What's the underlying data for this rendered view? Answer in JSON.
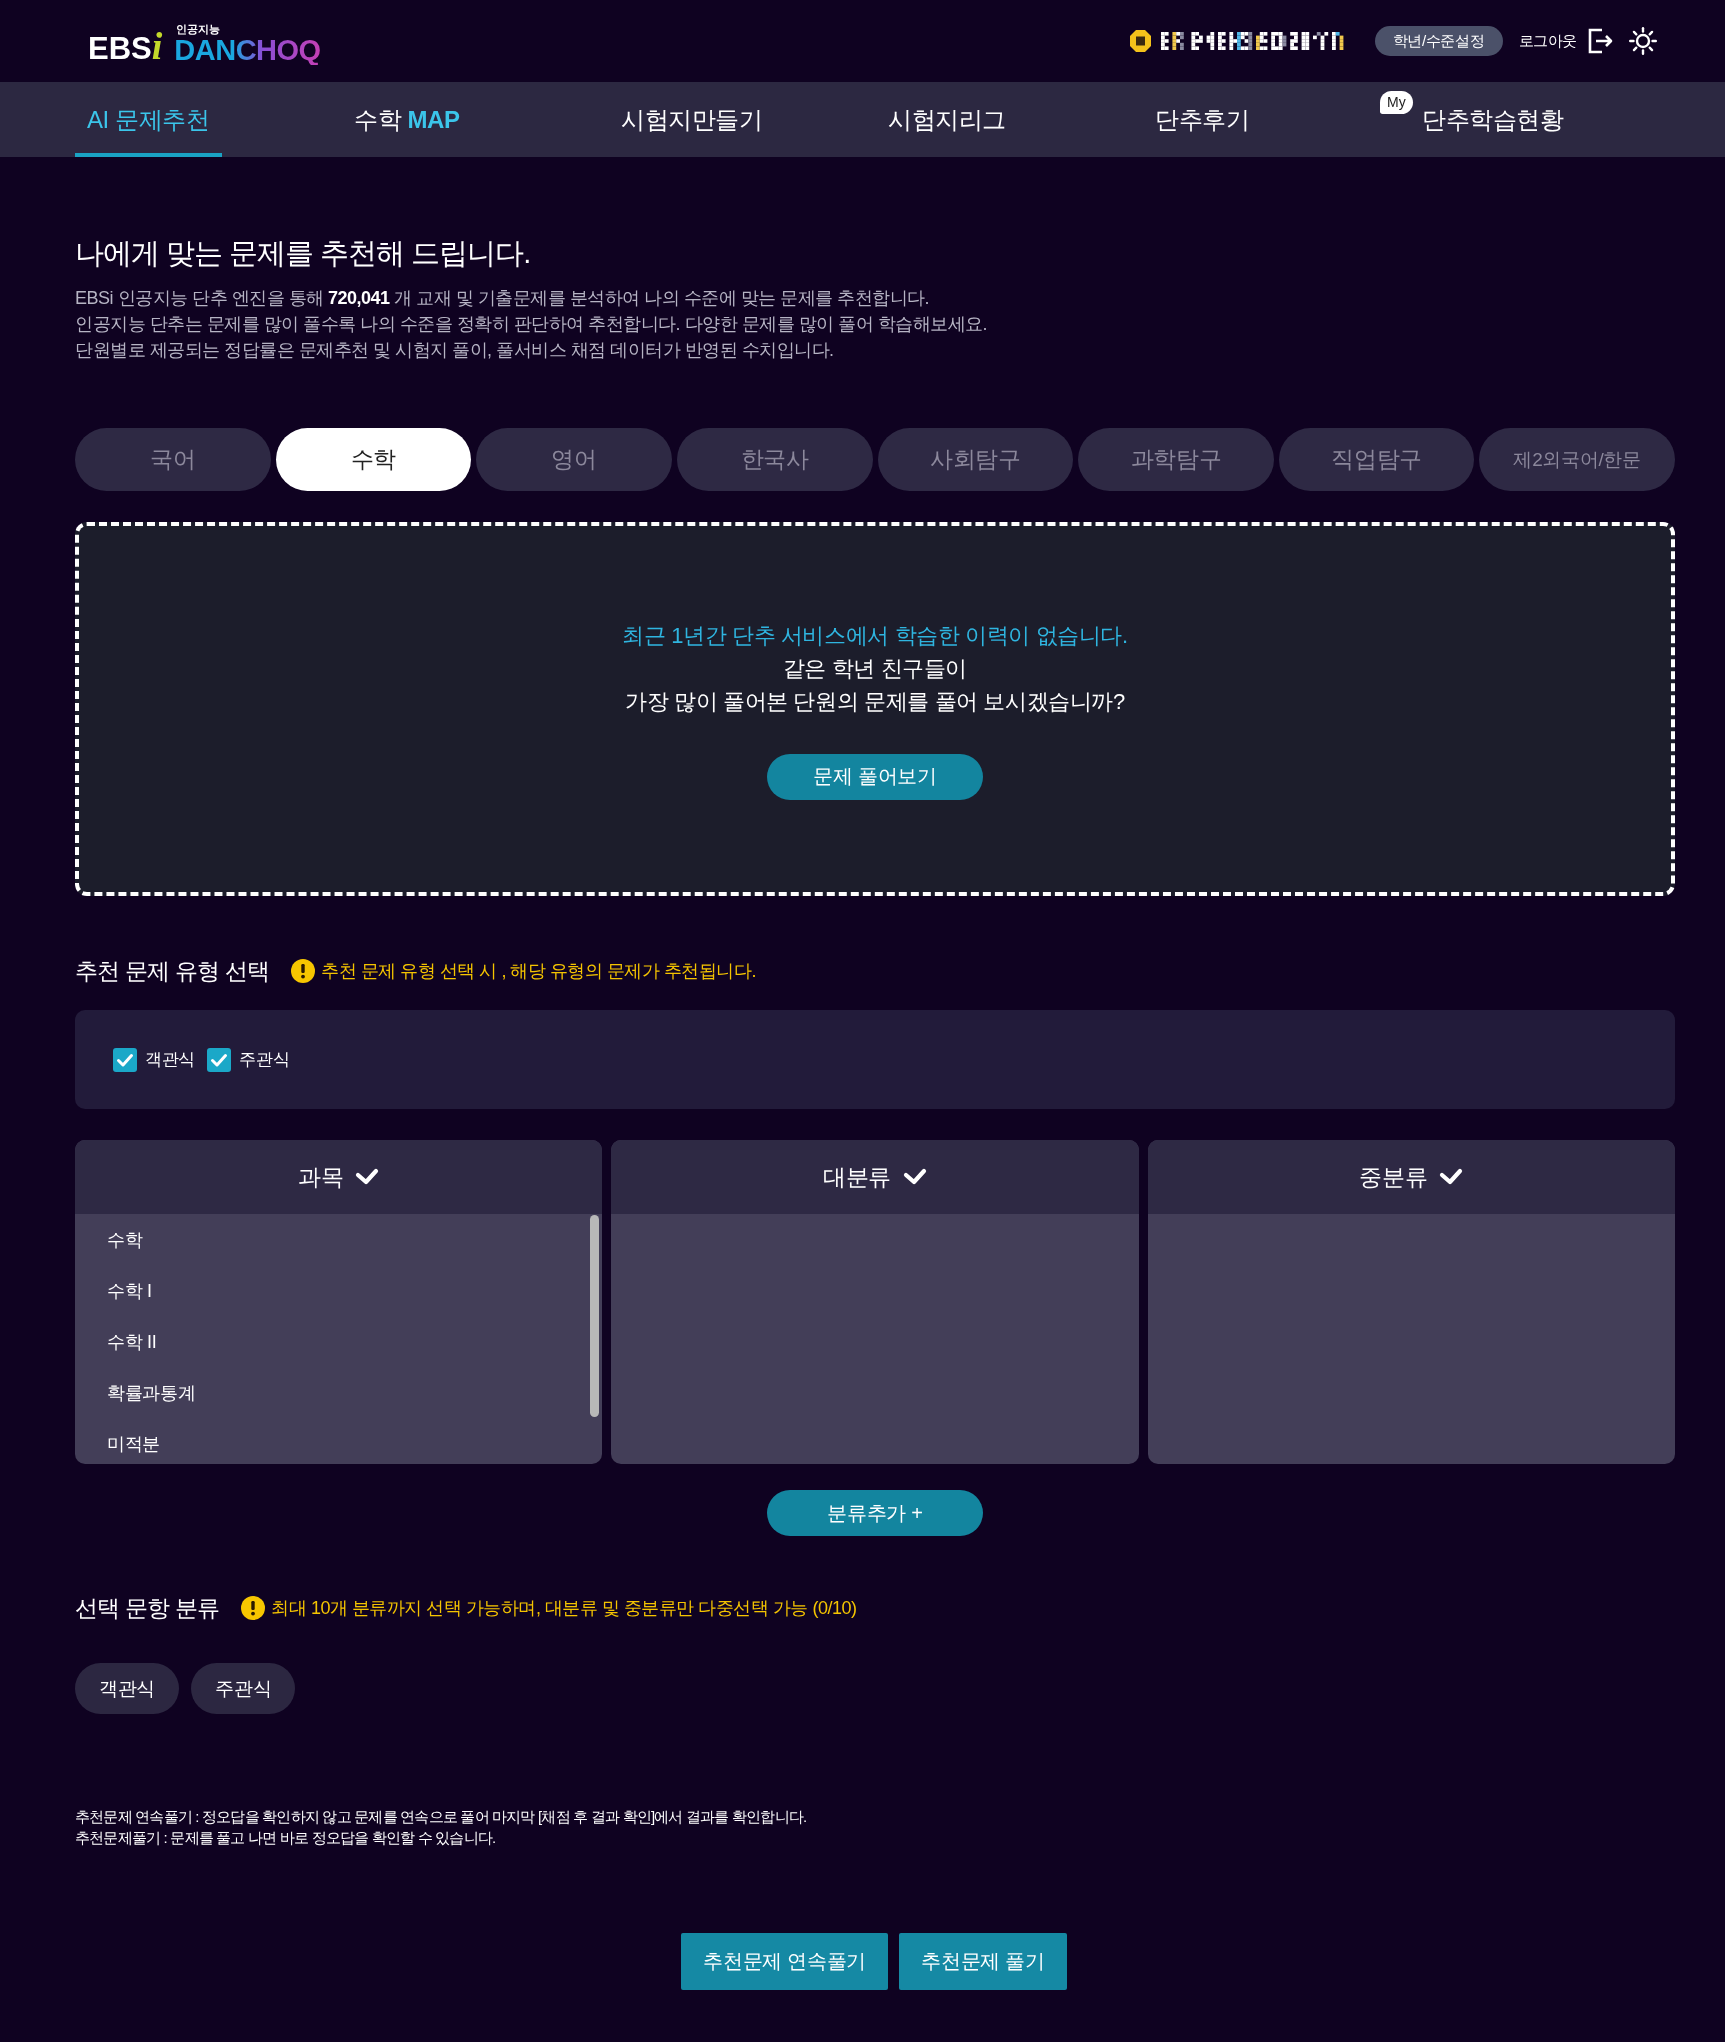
{
  "header": {
    "logo": {
      "brand": "EBS",
      "brand_accent": "i",
      "tagline": "인공지능",
      "name": "DANCHOQ"
    },
    "grade_button": "학년/수준설정",
    "logout": "로그아웃"
  },
  "nav": [
    {
      "label": "AI 문제추천",
      "selected": true
    },
    {
      "label": "수학",
      "accent": "MAP",
      "selected": false
    },
    {
      "label": "시험지만들기",
      "selected": false
    },
    {
      "label": "시험지리그",
      "selected": false
    },
    {
      "label": "단추후기",
      "selected": false
    },
    {
      "label": "단추학습현황",
      "badge": "My",
      "selected": false
    }
  ],
  "intro": {
    "title": "나에게 맞는 문제를 추천해 드립니다.",
    "body": "EBSi 인공지능 단추 엔진을 통해 **720,041** 개 교재 및 기출문제를 분석하여 나의 수준에 맞는 문제를 추천합니다.\n인공지능 단추는 문제를 많이 풀수록 나의 수준을 정확히 판단하여 추천합니다. 다양한 문제를 많이 풀어 학습해보세요.\n단원별로 제공되는 정답률은 문제추천 및 시험지 풀이, 풀서비스 채점 데이터가 반영된 수치입니다."
  },
  "subjects": [
    {
      "label": "국어",
      "selected": false
    },
    {
      "label": "수학",
      "selected": true
    },
    {
      "label": "영어",
      "selected": false
    },
    {
      "label": "한국사",
      "selected": false
    },
    {
      "label": "사회탐구",
      "selected": false
    },
    {
      "label": "과학탐구",
      "selected": false
    },
    {
      "label": "직업탐구",
      "selected": false
    },
    {
      "label": "제2외국어/한문",
      "selected": false
    }
  ],
  "empty_notice": {
    "message": "최근 1년간 단추 서비스에서 학습한 이력이 없습니다.",
    "prompt": "같은 학년 친구들이\n가장 많이 풀어본 단원의 문제를 풀어 보시겠습니까?",
    "button": "문제 풀어보기"
  },
  "type_section": {
    "title": "추천 문제 유형 선택",
    "warning": "추천 문제 유형 선택 시 , 해당 유형의 문제가 추천됩니다.",
    "options": [
      {
        "label": "객관식",
        "checked": true
      },
      {
        "label": "주관식",
        "checked": true
      }
    ]
  },
  "classifier": {
    "columns": [
      {
        "title": "과목",
        "items": [
          {
            "label": "수학",
            "selected": false
          },
          {
            "label": "수학 I",
            "selected": false
          },
          {
            "label": "수학 II",
            "selected": false
          },
          {
            "label": "확률과통계",
            "selected": false
          },
          {
            "label": "미적분",
            "selected": false
          }
        ]
      },
      {
        "title": "대분류"
      },
      {
        "title": "중분류"
      }
    ],
    "add_button": "분류추가 +"
  },
  "selected_section": {
    "title": "선택 문항 분류",
    "warning": "최대 10개 분류까지 선택 가능하며, 대분류 및 중분류만 다중선택 가능 (0/10)",
    "chips": [
      "객관식",
      "주관식"
    ]
  },
  "notes": [
    "추천문제 연속풀기 : 정오답을 확인하지 않고 문제를 연속으로 풀어 마지막 [채점 후 결과 확인]에서 결과를 확인합니다.",
    "추천문제풀기 : 문제를 풀고 나면 바로 정오답을 확인할 수 있습니다."
  ],
  "actions": [
    "추천문제 연속풀기",
    "추천문제 풀기"
  ]
}
